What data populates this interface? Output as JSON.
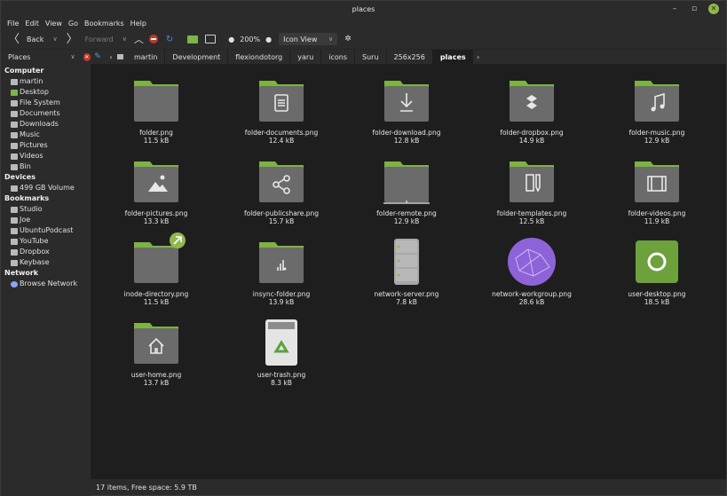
{
  "window": {
    "title": "places"
  },
  "menu": [
    "File",
    "Edit",
    "View",
    "Go",
    "Bookmarks",
    "Help"
  ],
  "toolbar": {
    "back": "Back",
    "forward": "Forward",
    "zoom": "200%",
    "view_mode": "Icon View"
  },
  "side_header": {
    "label": "Places"
  },
  "path": [
    "martin",
    "Development",
    "flexiondotorg",
    "yaru",
    "icons",
    "Suru",
    "256x256",
    "places"
  ],
  "sidebar": [
    {
      "type": "section",
      "label": "Computer"
    },
    {
      "type": "item",
      "label": "martin",
      "icon": "home-folder-icon",
      "color": "grey"
    },
    {
      "type": "item",
      "label": "Desktop",
      "icon": "desktop-icon",
      "color": "green"
    },
    {
      "type": "item",
      "label": "File System",
      "icon": "drive-icon",
      "color": "grey"
    },
    {
      "type": "item",
      "label": "Documents",
      "icon": "folder-icon",
      "color": "grey"
    },
    {
      "type": "item",
      "label": "Downloads",
      "icon": "folder-icon",
      "color": "grey"
    },
    {
      "type": "item",
      "label": "Music",
      "icon": "folder-icon",
      "color": "grey"
    },
    {
      "type": "item",
      "label": "Pictures",
      "icon": "folder-icon",
      "color": "grey"
    },
    {
      "type": "item",
      "label": "Videos",
      "icon": "folder-icon",
      "color": "grey"
    },
    {
      "type": "item",
      "label": "Bin",
      "icon": "trash-icon",
      "color": "grey"
    },
    {
      "type": "section",
      "label": "Devices"
    },
    {
      "type": "item",
      "label": "499 GB Volume",
      "icon": "drive-icon",
      "color": "grey"
    },
    {
      "type": "section",
      "label": "Bookmarks"
    },
    {
      "type": "item",
      "label": "Studio",
      "icon": "folder-icon",
      "color": "grey"
    },
    {
      "type": "item",
      "label": "Joe",
      "icon": "folder-icon",
      "color": "grey"
    },
    {
      "type": "item",
      "label": "UbuntuPodcast",
      "icon": "folder-icon",
      "color": "grey"
    },
    {
      "type": "item",
      "label": "YouTube",
      "icon": "folder-icon",
      "color": "grey"
    },
    {
      "type": "item",
      "label": "Dropbox",
      "icon": "folder-icon",
      "color": "grey"
    },
    {
      "type": "item",
      "label": "Keybase",
      "icon": "folder-icon",
      "color": "grey"
    },
    {
      "type": "section",
      "label": "Network"
    },
    {
      "type": "item",
      "label": "Browse Network",
      "icon": "network-icon",
      "color": "blue"
    }
  ],
  "files": [
    {
      "name": "folder.png",
      "size": "11.5 kB",
      "icon": "folder"
    },
    {
      "name": "folder-documents.png",
      "size": "12.4 kB",
      "icon": "documents"
    },
    {
      "name": "folder-download.png",
      "size": "12.8 kB",
      "icon": "download"
    },
    {
      "name": "folder-dropbox.png",
      "size": "14.9 kB",
      "icon": "dropbox"
    },
    {
      "name": "folder-music.png",
      "size": "12.9 kB",
      "icon": "music"
    },
    {
      "name": "folder-pictures.png",
      "size": "13.3 kB",
      "icon": "pictures"
    },
    {
      "name": "folder-publicshare.png",
      "size": "15.7 kB",
      "icon": "publicshare"
    },
    {
      "name": "folder-remote.png",
      "size": "12.9 kB",
      "icon": "remote"
    },
    {
      "name": "folder-templates.png",
      "size": "12.5 kB",
      "icon": "templates"
    },
    {
      "name": "folder-videos.png",
      "size": "11.9 kB",
      "icon": "videos"
    },
    {
      "name": "inode-directory.png",
      "size": "11.5 kB",
      "icon": "inode"
    },
    {
      "name": "insync-folder.png",
      "size": "13.9 kB",
      "icon": "insync"
    },
    {
      "name": "network-server.png",
      "size": "7.8 kB",
      "icon": "server"
    },
    {
      "name": "network-workgroup.png",
      "size": "28.6 kB",
      "icon": "workgroup"
    },
    {
      "name": "user-desktop.png",
      "size": "18.5 kB",
      "icon": "desktop"
    },
    {
      "name": "user-home.png",
      "size": "13.7 kB",
      "icon": "home"
    },
    {
      "name": "user-trash.png",
      "size": "8.3 kB",
      "icon": "trash"
    }
  ],
  "status": "17 items, Free space: 5.9 TB",
  "colors": {
    "folder_tab": "#7cb342",
    "folder_body": "#6b6b6b",
    "accent": "#8fb84e",
    "workgroup": "#8e63d8"
  }
}
